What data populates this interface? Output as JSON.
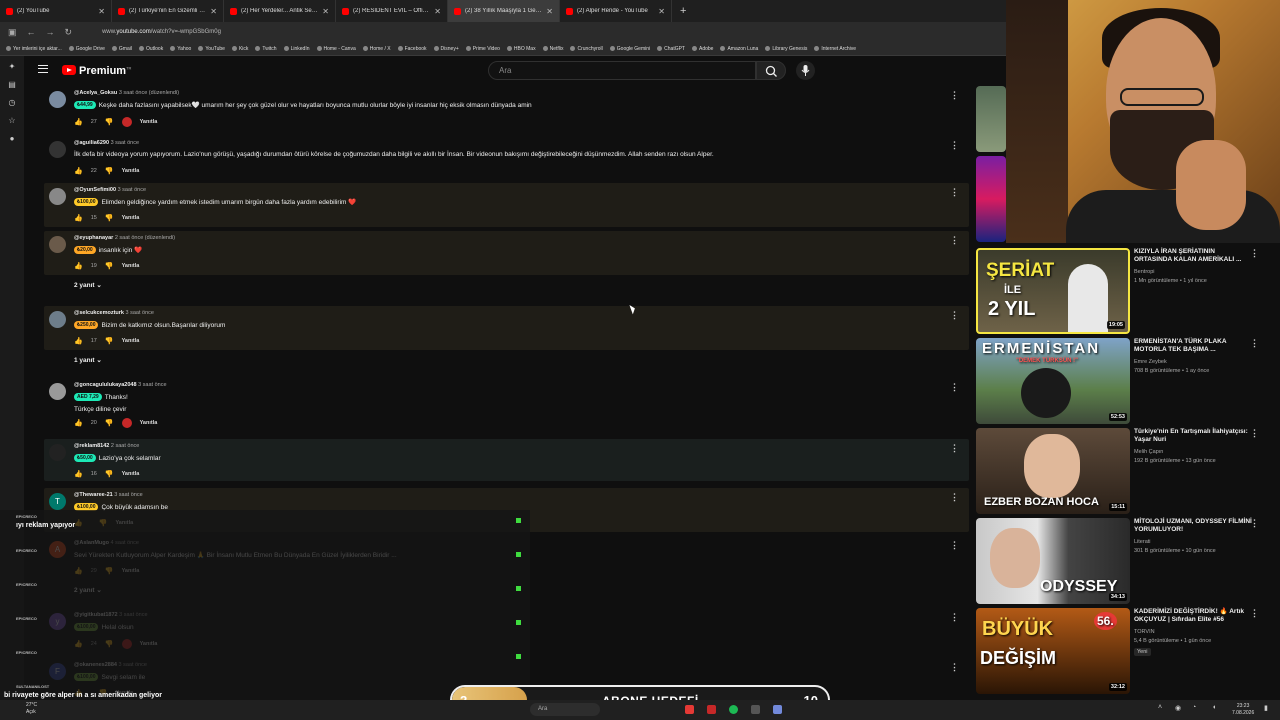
{
  "browser": {
    "tabs": [
      {
        "label": "(2) YouTube"
      },
      {
        "label": "(2) Türkiye'nin En Gizemli Olayı"
      },
      {
        "label": "(2) Her Yerdeler... Antik Sembol"
      },
      {
        "label": "(2) RESIDENT EVIL – Official Tra"
      },
      {
        "label": "(2) 38 Yıllık Maaşıyla 1 Gece Lü"
      },
      {
        "label": "(2) Alper Rende - YouTube"
      }
    ],
    "new_tab": "+",
    "url_prefix": "www.",
    "url_domain": "youtube.com",
    "url_path": "/watch?v=-wmpGSbGm0g",
    "bookmarks": [
      "Yer imlerini içe aktar...",
      "Google Drive",
      "Gmail",
      "Outlook",
      "Yahoo",
      "YouTube",
      "Kick",
      "Twitch",
      "LinkedIn",
      "Home - Canva",
      "Home / X",
      "Facebook",
      "Disney+",
      "Prime Video",
      "HBO Max",
      "Netflix",
      "Crunchyroll",
      "Google Gemini",
      "ChatGPT",
      "Adobe",
      "Amazon Luna",
      "Library Genesis",
      "Internet Archive"
    ]
  },
  "youtube": {
    "brand": "Premium",
    "brand_sup": "TR",
    "search_placeholder": "Ara"
  },
  "comments": [
    {
      "handle": "@Acelya_Goksu",
      "time": "3 saat önce (düzenlendi)",
      "chip": "₺44,99",
      "chip_color": "cyan",
      "text": "Keşke daha fazlasını yapabilsek🤍 umarım her şey çok güzel olur ve hayatları boyunca mutlu olurlar böyle iyi insanlar hiç eksik olmasın dünyada amin",
      "likes": "27",
      "reply": "Yanıtla"
    },
    {
      "handle": "@aguilia6290",
      "time": "3 saat önce",
      "chip": "",
      "text": "İlk defa bir videoya yorum yapıyorum. Lazio'nun görüşü, yaşadığı durumdan ötürü körelse de çoğumuzdan daha bilgili ve akıllı bir İnsan. Bir videonun bakışımı değiştirebileceğini düşünmezdim. Allah senden razı olsun Alper.",
      "likes": "22",
      "reply": "Yanıtla"
    },
    {
      "handle": "@OyunSefimi00",
      "time": "3 saat önce",
      "chip": "₺100,00",
      "chip_color": "yellow",
      "text": "Elimden geldiğince yardım etmek istedim umarım birgün daha fazla yardım edebilirim ❤️",
      "likes": "15",
      "reply": "Yanıtla"
    },
    {
      "handle": "@eyuphanayar",
      "time": "2 saat önce (düzenlendi)",
      "chip": "₺20,00",
      "chip_color": "orange",
      "text": "insanlık için ❤️",
      "likes": "19",
      "reply": "Yanıtla",
      "replies": "2 yanıt"
    },
    {
      "handle": "@selcukcemozturk",
      "time": "3 saat önce",
      "chip": "₺250,00",
      "chip_color": "orange",
      "text": "Bizim de katkımız olsun.Başarılar diliyorum",
      "likes": "17",
      "reply": "Yanıtla",
      "replies": "1 yanıt"
    },
    {
      "handle": "@goncagululukaya2048",
      "time": "3 saat önce",
      "chip": "AED 7,29",
      "chip_color": "cyan",
      "text": "Thanks!",
      "extra": "Türkçe diline çevir",
      "likes": "20",
      "reply": "Yanıtla"
    },
    {
      "handle": "@reklam8142",
      "time": "2 saat önce",
      "chip": "₺50,00",
      "chip_color": "cyan",
      "text": "Lazio'ya çok selamlar",
      "likes": "16",
      "reply": "Yanıtla"
    },
    {
      "handle": "@Thewaree-21",
      "time": "3 saat önce",
      "chip": "₺100,00",
      "chip_color": "yellow",
      "text": "Çok büyük adamsın be",
      "likes": "",
      "reply": "Yanıtla"
    },
    {
      "handle": "@AslanMugo",
      "time": "4 saat önce",
      "chip": "",
      "text": "Sevi Yürekten Kutluyorum Alper Kardeşim 🙏 Bir İnsanı Mutlu Etmen Bu Dünyada En Güzel İyiliklerden Biridir ...",
      "likes": "29",
      "reply": "Yanıtla",
      "replies": "2 yanıt"
    },
    {
      "handle": "@yigitkubat1872",
      "time": "3 saat önce",
      "chip": "₺100,00",
      "chip_color": "green",
      "text": "Helal olsun",
      "likes": "24",
      "reply": "Yanıtla"
    },
    {
      "handle": "@okanenes2884",
      "time": "3 saat önce",
      "chip": "₺100,00",
      "chip_color": "green",
      "text": "Sevgi selam ile",
      "likes": "",
      "reply": "Yanıtla"
    }
  ],
  "recommended": [
    {
      "title": "KIZIYLA İRAN ŞERİATININ ORTASINDA KALAN AMERİKALI ...",
      "channel": "Bentropi",
      "stats": "1 Mn görüntüleme • 1 yıl önce",
      "duration": "19:05",
      "thumb_text_1": "ŞERİAT",
      "thumb_text_2": "İLE",
      "thumb_text_3": "2 YIL",
      "badge": ""
    },
    {
      "title": "ERMENİSTAN'A TÜRK PLAKA MOTORLA TEK BAŞIMA ...",
      "channel": "Emre Zeybek",
      "stats": "708 B görüntüleme • 1 ay önce",
      "duration": "52:53",
      "thumb_text_1": "ERMENİSTAN",
      "thumb_text_2": "\"DEMEK TÜRKSÜN !\"",
      "badge": ""
    },
    {
      "title": "Türkiye'nin En Tartışmalı İlahiyatçısı: Yaşar Nuri",
      "channel": "Melih Çapın",
      "stats": "192 B görüntüleme • 13 gün önce",
      "duration": "15:11",
      "thumb_text_1": "EZBER BOZAN HOCA",
      "badge": ""
    },
    {
      "title": "MİTOLOJİ UZMANI, ODYSSEY FİLMİNİ YORUMLUYOR!",
      "channel": "Literati",
      "stats": "301 B görüntüleme • 10 gün önce",
      "duration": "34:13",
      "thumb_text_1": "ODYSSEY",
      "badge": ""
    },
    {
      "title": "KADERİMİZİ DEĞİŞTİRDİK! 🔥 Artık OKÇUYUZ | Sıfırdan Elite #56",
      "channel": "TORVIN",
      "stats": "5,4 B görüntüleme • 1 gün önce",
      "duration": "32:12",
      "thumb_text_1": "BÜYÜK",
      "thumb_text_2": "DEĞİŞİM",
      "thumb_text_3": "56.",
      "badge": "Yeni"
    }
  ],
  "stream_chat": [
    {
      "user": "EPICRECO",
      "text": "ıyı reklam yapıyor"
    },
    {
      "user": "EPICRECO",
      "text": ""
    },
    {
      "user": "EPICRECO",
      "text": ""
    },
    {
      "user": "EPICRECO",
      "text": ""
    },
    {
      "user": "EPICRECO",
      "text": ""
    }
  ],
  "ticker": {
    "user": "SULTANANILOST",
    "text": "bi rivayete göre alper in a sı amerikadan geliyor"
  },
  "goal": {
    "current": "2",
    "label": "ABONE HEDEFİ",
    "max": "10",
    "progress": 0.2
  },
  "taskbar": {
    "weather_temp": "27°C",
    "weather_desc": "Açık",
    "search": "Ara",
    "time": "23:23",
    "date": "7.08.2026"
  },
  "colors": {
    "accent": "#ff0000",
    "chip_cyan": "#1de9b6",
    "chip_yellow": "#ffca28",
    "goal_fill": "#e8c479"
  }
}
